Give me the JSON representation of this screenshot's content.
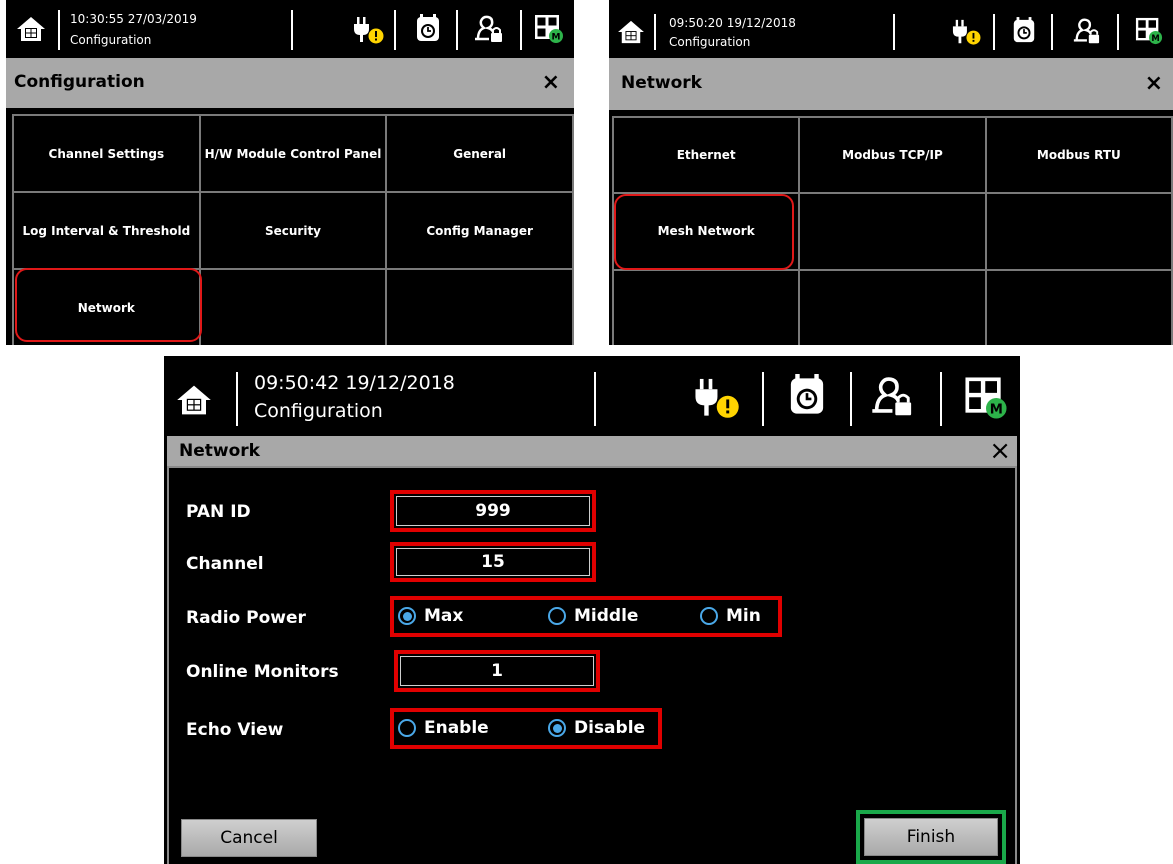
{
  "screens": {
    "configuration": {
      "time": "10:30:55 27/03/2019",
      "page": "Configuration",
      "title": "Configuration",
      "close": "×",
      "cells": [
        "Channel Settings",
        "H/W Module Control Panel",
        "General",
        "Log Interval & Threshold",
        "Security",
        "Config Manager",
        "Network",
        "",
        ""
      ]
    },
    "network_menu": {
      "time": "09:50:20 19/12/2018",
      "page": "Configuration",
      "title": "Network",
      "close": "×",
      "cells": [
        "Ethernet",
        "Modbus TCP/IP",
        "Modbus RTU",
        "Mesh Network",
        "",
        "",
        "",
        "",
        ""
      ]
    },
    "network_form": {
      "time": "09:50:42 19/12/2018",
      "page": "Configuration",
      "title": "Network",
      "close": "×",
      "labels": {
        "pan_id": "PAN ID",
        "channel": "Channel",
        "radio_power": "Radio Power",
        "online_monitors": "Online Monitors",
        "echo_view": "Echo View"
      },
      "values": {
        "pan_id": "999",
        "channel": "15",
        "online_monitors": "1"
      },
      "radio_power_options": [
        "Max",
        "Middle",
        "Min"
      ],
      "radio_power_selected": "Max",
      "echo_view_options": [
        "Enable",
        "Disable"
      ],
      "echo_view_selected": "Disable",
      "cancel": "Cancel",
      "finish": "Finish"
    }
  },
  "colors": {
    "highlight_red": "#e00000",
    "highlight_green": "#1aa84a",
    "radio_blue": "#4aa8e8",
    "title_bar": "#a8a8a8",
    "warning_yellow": "#ffd400",
    "mesh_green": "#2db34a"
  },
  "icons": [
    "home-icon",
    "power-plug-warning-icon",
    "alarm-clock-icon",
    "user-lock-icon",
    "module-mesh-icon",
    "close-icon"
  ]
}
